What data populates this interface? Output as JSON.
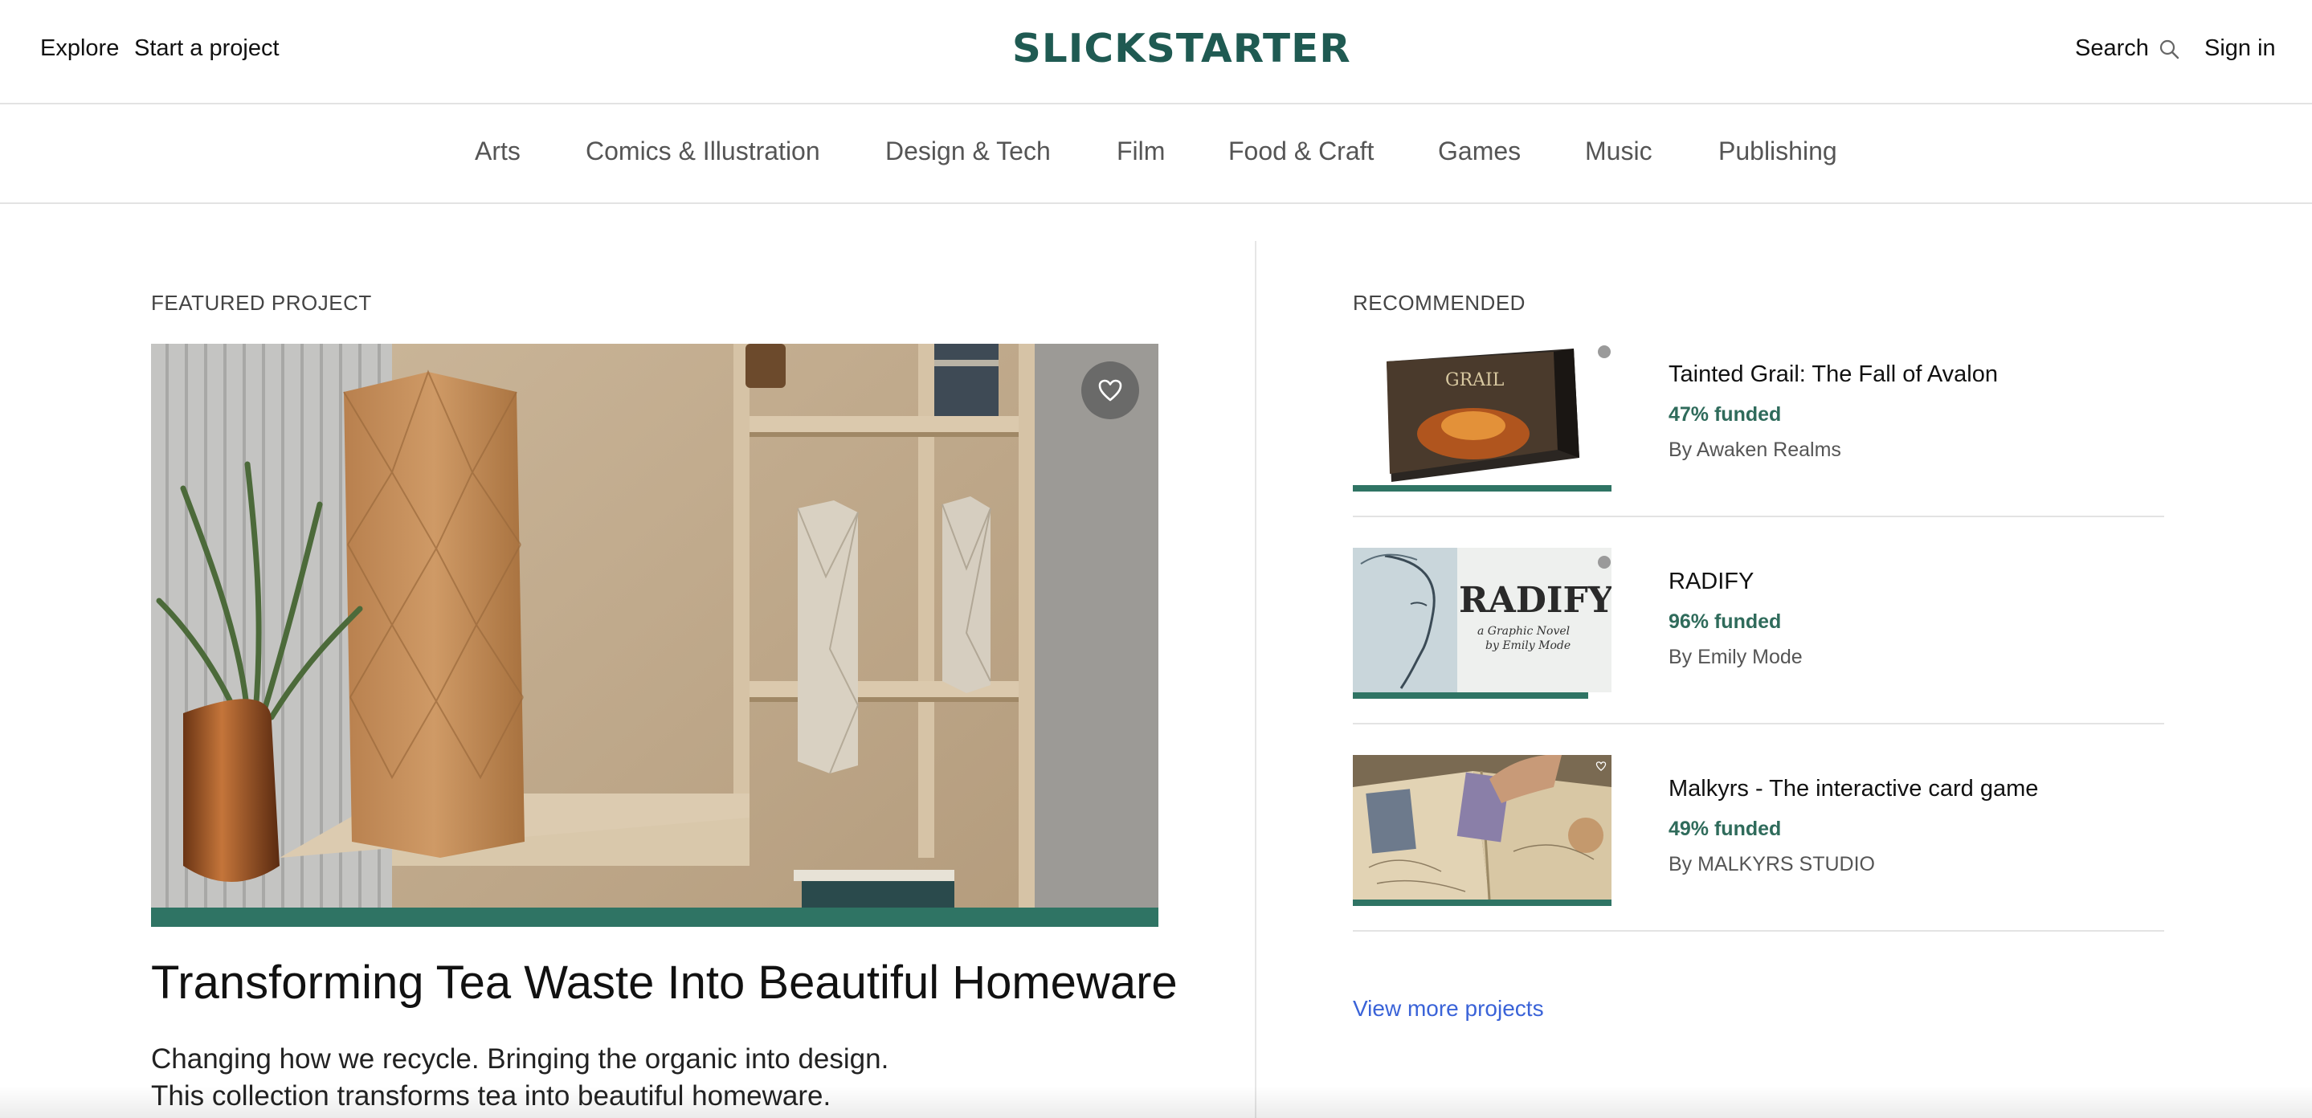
{
  "header": {
    "explore": "Explore",
    "start_project": "Start a project",
    "logo": "SLICKSTARTER",
    "search": "Search",
    "sign_in": "Sign in"
  },
  "categories": [
    "Arts",
    "Comics & Illustration",
    "Design & Tech",
    "Film",
    "Food & Craft",
    "Games",
    "Music",
    "Publishing"
  ],
  "featured": {
    "label": "FEATURED PROJECT",
    "title": "Transforming Tea Waste Into Beautiful Homeware",
    "desc_line1": "Changing how we recycle. Bringing the organic into design.",
    "desc_line2": "This collection transforms tea into beautiful homeware.",
    "funded_fraction": 1.0
  },
  "recommended": {
    "label": "RECOMMENDED",
    "items": [
      {
        "title": "Tainted Grail: The Fall of Avalon",
        "funded": "47% funded",
        "by": "By Awaken Realms",
        "funded_fraction": 1.0,
        "thumb_text": "GRAIL"
      },
      {
        "title": "RADIFY",
        "funded": "96% funded",
        "by": "By Emily Mode",
        "funded_fraction": 0.91,
        "thumb_text": "RADIFY",
        "thumb_sub1": "a Graphic Novel",
        "thumb_sub2": "by Emily Mode"
      },
      {
        "title": "Malkyrs - The interactive card game",
        "funded": "49% funded",
        "by": "By MALKYRS STUDIO",
        "funded_fraction": 1.0,
        "thumb_text": ""
      }
    ],
    "view_more": "View more projects"
  },
  "colors": {
    "brand": "#1f5a52",
    "funded_green": "#2f6b5b",
    "progress": "#2f7464",
    "link_blue": "#3a63d8"
  },
  "icons": [
    "search-icon",
    "heart-icon"
  ]
}
